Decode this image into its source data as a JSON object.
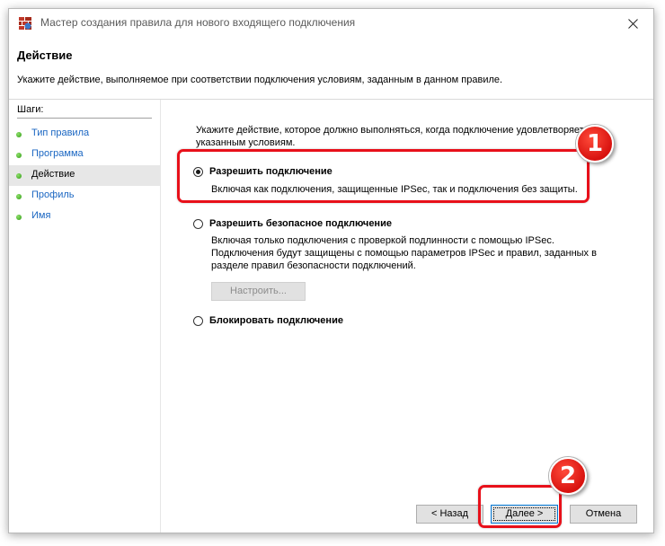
{
  "window": {
    "title": "Мастер создания правила для нового входящего подключения",
    "close_icon": "close-icon"
  },
  "header": {
    "title": "Действие",
    "subtitle": "Укажите действие, выполняемое при соответствии подключения условиям, заданным в данном правиле."
  },
  "sidebar": {
    "title": "Шаги:",
    "items": [
      {
        "label": "Тип правила",
        "active": false
      },
      {
        "label": "Программа",
        "active": false
      },
      {
        "label": "Действие",
        "active": true
      },
      {
        "label": "Профиль",
        "active": false
      },
      {
        "label": "Имя",
        "active": false
      }
    ]
  },
  "main": {
    "intro": "Укажите действие, которое должно выполняться, когда подключение удовлетворяет указанным условиям.",
    "options": [
      {
        "label": "Разрешить подключение",
        "checked": true,
        "description": "Включая как подключения, защищенные IPSec, так и подключения без защиты."
      },
      {
        "label": "Разрешить безопасное подключение",
        "checked": false,
        "description": "Включая только подключения с проверкой подлинности с помощью IPSec. Подключения будут защищены с помощью параметров IPSec и правил, заданных в разделе правил безопасности подключений."
      },
      {
        "label": "Блокировать подключение",
        "checked": false,
        "description": ""
      }
    ],
    "customize_label": "Настроить..."
  },
  "footer": {
    "back_label": "< Назад",
    "next_label": "Далее >",
    "cancel_label": "Отмена"
  },
  "annotations": {
    "badge1": "1",
    "badge2": "2",
    "color": "#e8101a"
  }
}
